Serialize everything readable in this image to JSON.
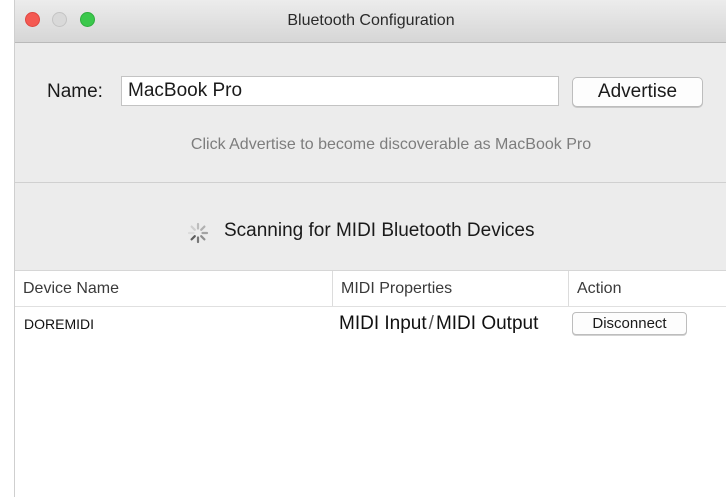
{
  "window": {
    "title": "Bluetooth Configuration"
  },
  "advertise": {
    "name_label": "Name:",
    "name_value": "MacBook Pro",
    "button_label": "Advertise",
    "hint": "Click Advertise to become discoverable as MacBook Pro"
  },
  "scan": {
    "status": "Scanning for MIDI Bluetooth Devices",
    "icon": "spinner-icon"
  },
  "table": {
    "columns": [
      "Device Name",
      "MIDI Properties",
      "Action"
    ],
    "rows": [
      {
        "device_name": "DOREMIDI",
        "prop_input": "MIDI Input",
        "prop_separator": "/",
        "prop_output": "MIDI Output",
        "action_label": "Disconnect"
      }
    ]
  },
  "colors": {
    "close": "#f45952",
    "minimize": "#d9d9d9",
    "zoom": "#3bc84c"
  }
}
